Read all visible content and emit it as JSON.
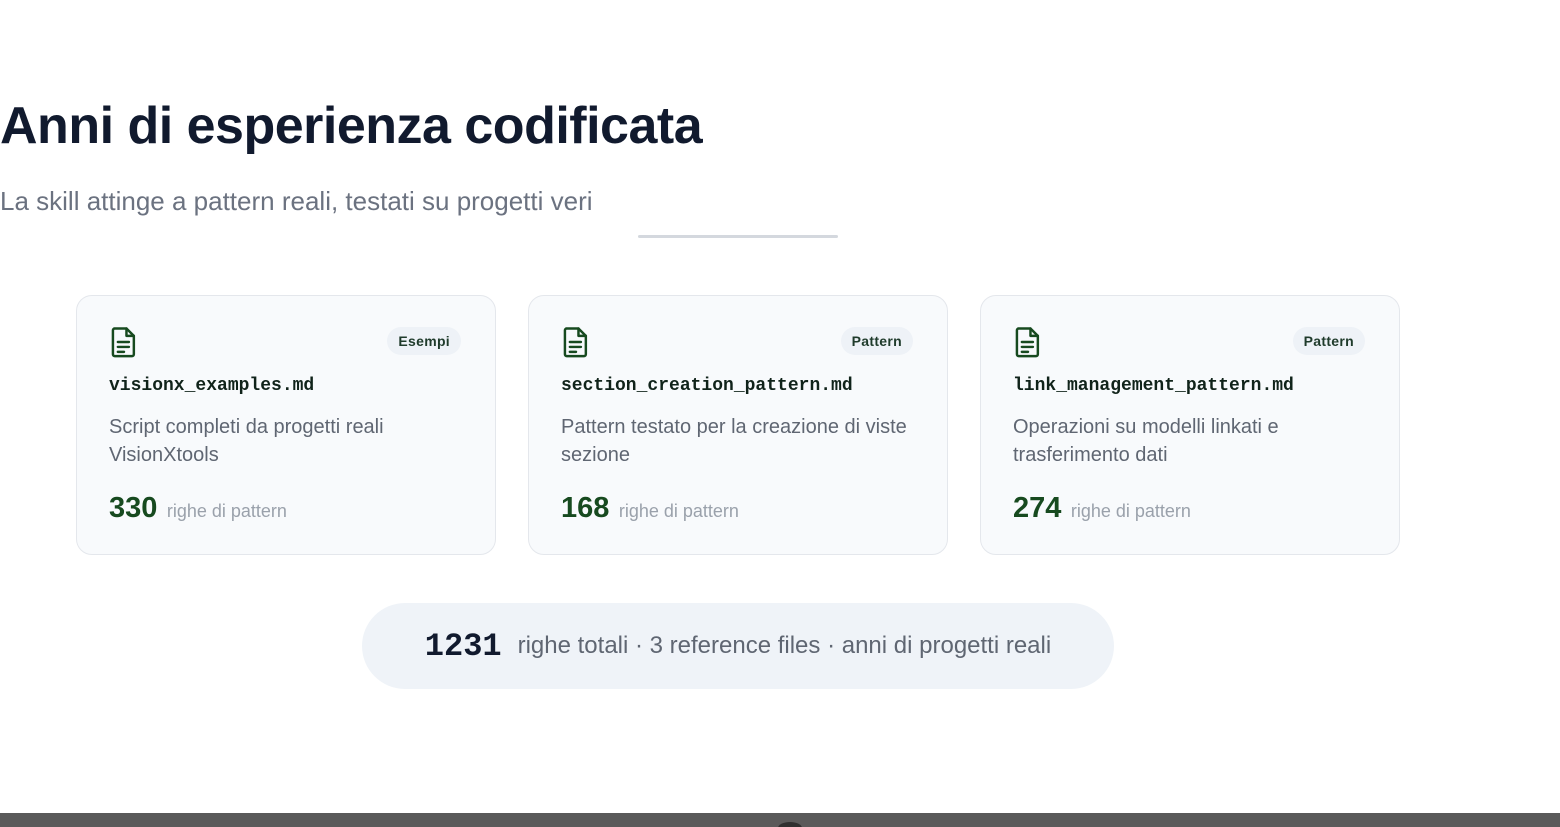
{
  "header": {
    "title": "Anni di esperienza codificata",
    "subtitle": "La skill attinge a pattern reali, testati su progetti veri"
  },
  "cards": [
    {
      "badge": "Esempi",
      "filename": "visionx_examples.md",
      "description": "Script completi da progetti reali VisionXtools",
      "lines": "330",
      "lines_label": "righe di pattern",
      "icon": "document-icon"
    },
    {
      "badge": "Pattern",
      "filename": "section_creation_pattern.md",
      "description": "Pattern testato per la creazione di viste sezione",
      "lines": "168",
      "lines_label": "righe di pattern",
      "icon": "document-icon"
    },
    {
      "badge": "Pattern",
      "filename": "link_management_pattern.md",
      "description": "Operazioni su modelli linkati e trasferimento dati",
      "lines": "274",
      "lines_label": "righe di pattern",
      "icon": "document-icon"
    }
  ],
  "summary": {
    "total": "1231",
    "text": "righe totali · 3 reference files · anni di progetti reali"
  },
  "colors": {
    "accent_green": "#174a1f",
    "title": "#111a2e",
    "card_bg": "#f8fafc",
    "summary_bg": "#eff3f8"
  }
}
